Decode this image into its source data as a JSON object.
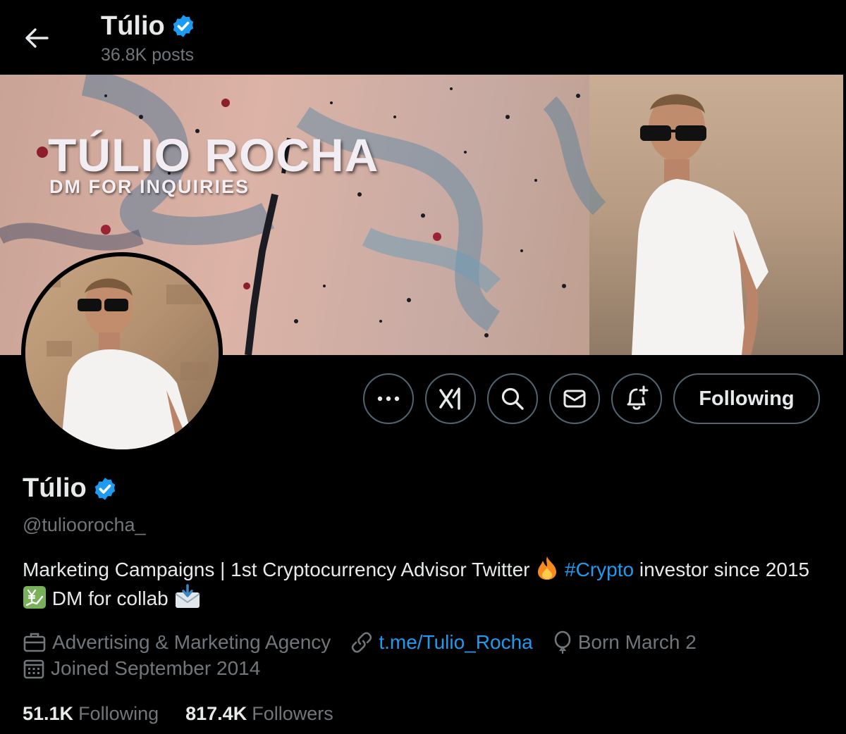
{
  "header": {
    "title": "Túlio",
    "posts_count": "36.8K posts"
  },
  "banner": {
    "title": "TÚLIO ROCHA",
    "subtitle": "DM FOR INQUIRIES"
  },
  "actions": {
    "following_label": "Following"
  },
  "profile": {
    "name": "Túlio",
    "handle": "@tulioorocha_",
    "bio_part1": "Marketing Campaigns | 1st Cryptocurrency Advisor Twitter ",
    "bio_hashtag": "#Crypto",
    "bio_part2": " investor since 2015 ",
    "bio_part3": " DM for collab ",
    "category": "Advertising & Marketing Agency",
    "link": "t.me/Tulio_Rocha",
    "birthday": "Born March 2",
    "joined": "Joined September 2014"
  },
  "stats": {
    "following_count": "51.1K",
    "following_label": "Following",
    "followers_count": "817.4K",
    "followers_label": "Followers"
  },
  "colors": {
    "accent": "#1d9bf0",
    "muted": "#71767b",
    "border": "#536471",
    "text": "#e7e9ea"
  }
}
